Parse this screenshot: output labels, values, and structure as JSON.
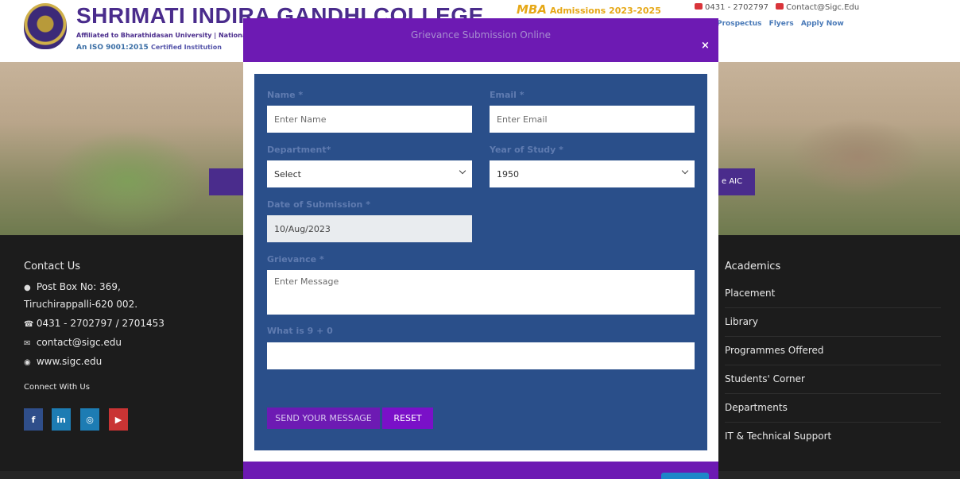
{
  "header": {
    "college_name": "SHRIMATI INDIRA GANDHI COLLEGE",
    "affiliation": "Affiliated to Bharathidasan University | Nationally A",
    "iso": "An ISO 9001:2015",
    "iso_suffix": "Certified Institution",
    "mba_highlight": "MBA",
    "mba_text": "Admissions 2023-2025",
    "phone": "0431 - 2702797",
    "email": "Contact@Sigc.Edu",
    "links": [
      "Prospectus",
      "Flyers",
      "Apply Now"
    ]
  },
  "hero": {
    "right_button_label": "e AIC"
  },
  "footer": {
    "contact_heading": "Contact Us",
    "address_line1": "Post Box No: 369,",
    "address_line2": "Tiruchirappalli-620 002.",
    "phone": "0431 - 2702797 / 2701453",
    "email": "contact@sigc.edu",
    "website": "www.sigc.edu",
    "connect_label": "Connect With Us",
    "social_icons": [
      "facebook-icon",
      "linkedin-icon",
      "instagram-icon",
      "youtube-icon"
    ],
    "academics_heading": "Academics",
    "academics_links": [
      "Placement",
      "Library",
      "Programmes Offered",
      "Students' Corner",
      "Departments",
      "IT & Technical Support"
    ]
  },
  "modal": {
    "title": "Grievance Submission Online",
    "close_glyph": "×",
    "name_label": "Name",
    "name_placeholder": "Enter Name",
    "email_label": "Email",
    "email_placeholder": "Enter Email",
    "department_label": "Department",
    "department_value": "Select",
    "year_label": "Year of Study",
    "year_value": "1950",
    "date_label": "Date of Submission",
    "date_value": "10/Aug/2023",
    "grievance_label": "Grievance",
    "grievance_placeholder": "Enter Message",
    "captcha_label": "What is 9 + 0",
    "captcha_value": "",
    "required_mark": "*",
    "send_label": "SEND YOUR MESSAGE",
    "reset_label": "RESET"
  },
  "colors": {
    "modal_header": "#6d1ab3",
    "form_panel": "#2a4f8a",
    "brand_purple": "#4a2c8c",
    "footer_bg": "#1c1c1c"
  }
}
